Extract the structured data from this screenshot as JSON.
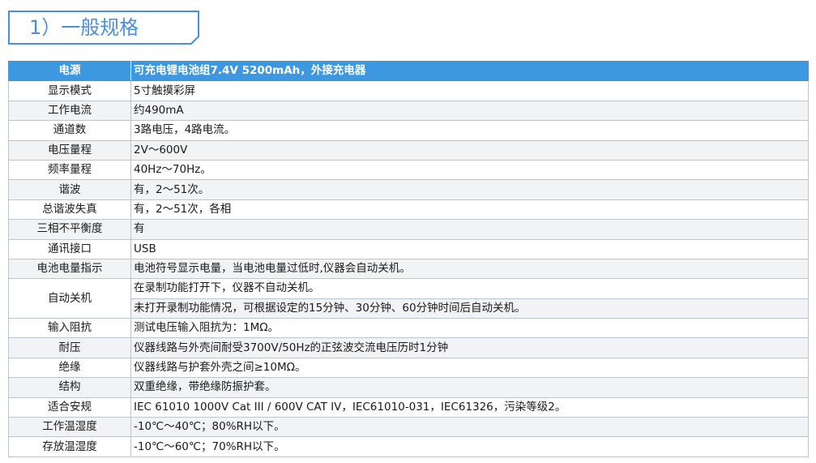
{
  "section_title": "1）一般规格",
  "rows": [
    {
      "k": "电源",
      "v": [
        "可充电锂电池组7.4V 5200mAh，外接充电器"
      ]
    },
    {
      "k": "显示模式",
      "v": [
        "5寸触摸彩屏"
      ]
    },
    {
      "k": "工作电流",
      "v": [
        "约490mA"
      ]
    },
    {
      "k": "通道数",
      "v": [
        "3路电压，4路电流。"
      ]
    },
    {
      "k": "电压量程",
      "v": [
        "2V～600V"
      ]
    },
    {
      "k": "频率量程",
      "v": [
        "40Hz～70Hz。"
      ]
    },
    {
      "k": "谐波",
      "v": [
        "有，2～51次。"
      ]
    },
    {
      "k": "总谐波失真",
      "v": [
        "有，2～51次，各相"
      ]
    },
    {
      "k": "三相不平衡度",
      "v": [
        "有"
      ]
    },
    {
      "k": "通讯接口",
      "v": [
        "USB"
      ]
    },
    {
      "k": "电池电量指示",
      "v": [
        "电池符号显示电量，当电池电量过低时,仪器会自动关机。"
      ]
    },
    {
      "k": "自动关机",
      "v": [
        "在录制功能打开下，仪器不自动关机。",
        "未打开录制功能情况，可根据设定的15分钟、30分钟、60分钟时间后自动关机。"
      ]
    },
    {
      "k": "输入阻抗",
      "v": [
        "测试电压输入阻抗为：1MΩ。"
      ]
    },
    {
      "k": "耐压",
      "v": [
        "仪器线路与外壳间耐受3700V/50Hz的正弦波交流电压历时1分钟"
      ]
    },
    {
      "k": "绝缘",
      "v": [
        "仪器线路与护套外壳之间≥10MΩ。"
      ]
    },
    {
      "k": "结构",
      "v": [
        "双重绝缘，带绝缘防振护套。"
      ]
    },
    {
      "k": "适合安规",
      "v": [
        "IEC 61010 1000V Cat III / 600V CAT IV，IEC61010-031，IEC61326，污染等级2。"
      ]
    },
    {
      "k": "工作温湿度",
      "v": [
        "-10℃～40℃；80%RH以下。"
      ]
    },
    {
      "k": "存放温湿度",
      "v": [
        "-10℃～60℃；70%RH以下。"
      ]
    }
  ]
}
